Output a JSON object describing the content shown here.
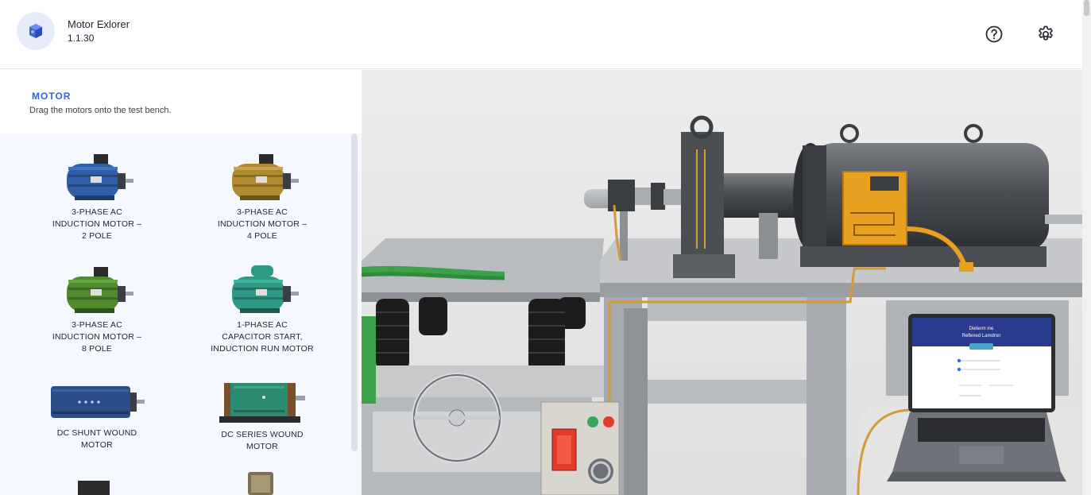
{
  "app": {
    "name": "Motor Exlorer",
    "version": "1.1.30"
  },
  "header": {
    "help_icon": "question-circle-icon",
    "settings_icon": "gear-icon"
  },
  "sidebar": {
    "section_title": "MOTOR",
    "section_desc": "Drag the motors onto the test bench.",
    "motors": [
      {
        "label": "3-PHASE AC\nINDUCTION MOTOR –\n2 POLE",
        "color": "#2f5fa8"
      },
      {
        "label": "3-PHASE AC\nINDUCTION MOTOR –\n4 POLE",
        "color": "#b08a2e"
      },
      {
        "label": "3-PHASE AC\nINDUCTION MOTOR –\n8 POLE",
        "color": "#4f8a2e"
      },
      {
        "label": "1-PHASE AC\nCAPACITOR START,\nINDUCTION RUN MOTOR",
        "color": "#2e9a85"
      },
      {
        "label": "DC SHUNT WOUND\nMOTOR",
        "color": "#2a4d8a"
      },
      {
        "label": "DC SERIES WOUND\nMOTOR",
        "color": "#2c8a70"
      }
    ]
  },
  "scene": {
    "laptop": {
      "title_line1": "Dieterm ine",
      "title_line2": "Reflexed Lamdron",
      "button": "Ace fun"
    }
  },
  "colors": {
    "accent": "#3461e3",
    "panel_bg": "#f5f8fe",
    "junction_box": "#e8a020"
  }
}
